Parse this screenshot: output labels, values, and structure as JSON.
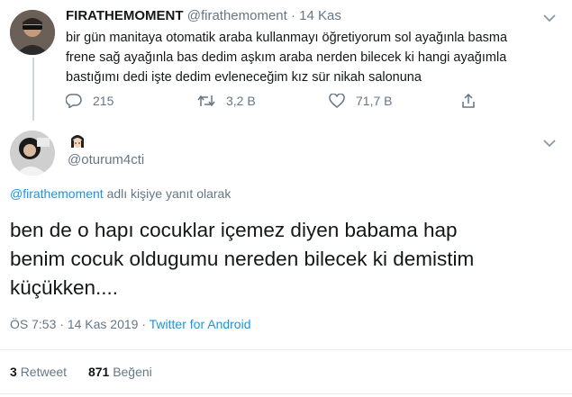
{
  "parent_tweet": {
    "display_name": "FIRATHEMOMENT",
    "handle": "@firathemoment",
    "dot": "·",
    "date": "14 Kas",
    "text_lines": [
      "bir gün manitaya otomatik araba kullanmayı öğretiyorum sol ayağınla basma",
      "frene sağ ayağınla bas dedim aşkım araba nerden bilecek ki hangi ayağımla",
      "bastığımı dedi işte dedim evleneceğim kız sür nikah salonuna"
    ],
    "replies": "215",
    "retweets": "3,2 B",
    "likes": "71,7 B"
  },
  "reply_tweet": {
    "handle": "@oturum4cti",
    "reply_to_handle": "@firathemoment",
    "reply_to_suffix": "adlı kişiye yanıt olarak",
    "text_lines": [
      "ben de o hapı cocuklar içemez diyen babama hap",
      "benim cocuk oldugumu nereden bilecek ki demistim",
      "küçükken...."
    ],
    "time": "ÖS 7:53",
    "sep1": "·",
    "date": "14 Kas 2019",
    "sep2": "·",
    "source": "Twitter for Android",
    "retweet_count": "3",
    "retweet_label": "Retweet",
    "like_count": "871",
    "like_label": "Beğeni"
  },
  "colors": {
    "accent": "#1b95e0",
    "muted": "#657786",
    "divider": "#e6ecf0"
  }
}
